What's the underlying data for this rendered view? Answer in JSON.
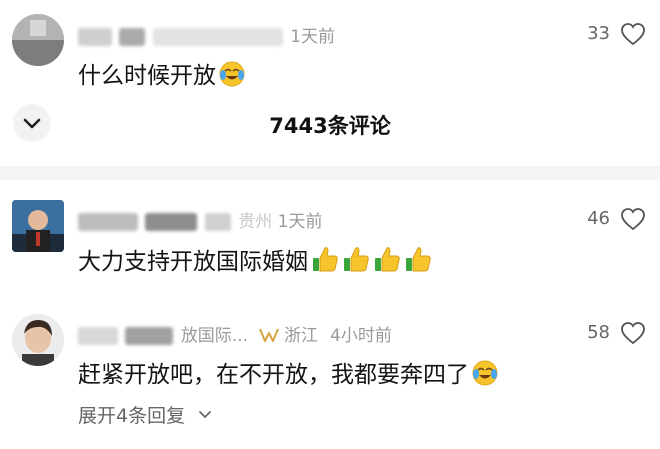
{
  "comments": [
    {
      "time": "1天前",
      "text": "什么时候开放",
      "likes": "33",
      "emoji": "crying-laughing-emoji"
    },
    {
      "time": "1天前",
      "location": "贵州",
      "text": "大力支持开放国际婚姻",
      "likes": "46",
      "emoji": "thumbs-up-emoji"
    },
    {
      "handle_fragment": "放国际...",
      "location": "浙江",
      "time": "4小时前",
      "text": "赶紧开放吧，在不开放，我都要奔四了",
      "likes": "58",
      "emoji": "crying-laughing-emoji",
      "expand_replies": "展开4条回复"
    }
  ],
  "comment_count": "7443条评论",
  "colors": {
    "text": "#141414",
    "meta": "#9a9a9a",
    "emoji_yellow": "#f7c52b",
    "thumb_green": "#3aa63a",
    "vip_gold": "#d9a441"
  }
}
